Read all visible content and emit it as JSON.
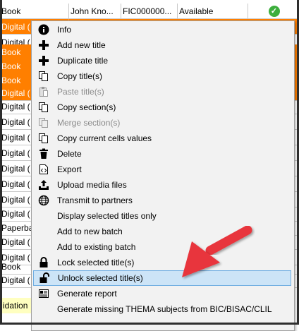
{
  "grid": {
    "top_row": [
      "Book",
      "John Kno...",
      "FIC000000...",
      "Available"
    ],
    "left_cells": [
      "Digital (",
      "Digital (",
      "Book",
      "Book",
      "Book",
      "Digital (",
      "Digital (",
      "Digital (",
      "Digital (",
      "Digital (",
      "Digital (",
      "Digital (",
      "Digital (",
      "Digital (",
      "Paperba",
      "Digital (",
      "Digital (",
      "Book",
      "Digital ("
    ],
    "validation_label": "idation"
  },
  "menu": {
    "items": [
      {
        "label": "Info",
        "icon": "info-icon"
      },
      {
        "label": "Add new title",
        "icon": "plus-icon"
      },
      {
        "label": "Duplicate title",
        "icon": "plus-icon"
      },
      {
        "label": "Copy title(s)",
        "icon": "copy-icon"
      },
      {
        "label": "Paste title(s)",
        "icon": "paste-icon"
      },
      {
        "label": "Copy section(s)",
        "icon": "copy-icon"
      },
      {
        "label": "Merge section(s)",
        "icon": "merge-icon"
      },
      {
        "label": "Copy current cells values",
        "icon": "copy-icon"
      },
      {
        "label": "Delete",
        "icon": "trash-icon"
      },
      {
        "label": "Export",
        "icon": "export-icon"
      },
      {
        "label": "Upload media files",
        "icon": "upload-icon"
      },
      {
        "label": "Transmit to partners",
        "icon": "globe-icon"
      },
      {
        "label": "Display selected titles only",
        "icon": ""
      },
      {
        "label": "Add to new batch",
        "icon": ""
      },
      {
        "label": "Add to existing batch",
        "icon": ""
      },
      {
        "label": "Lock selected title(s)",
        "icon": "lock-icon"
      },
      {
        "label": "Unlock selected title(s)",
        "icon": "unlock-icon"
      },
      {
        "label": "Generate report",
        "icon": "report-icon"
      },
      {
        "label": "Generate missing THEMA subjects from BIC/BISAC/CLIL",
        "icon": ""
      }
    ]
  },
  "colors": {
    "selection": "#ff7f00",
    "highlight": "#cce4f7",
    "arrow": "#e8363c"
  }
}
